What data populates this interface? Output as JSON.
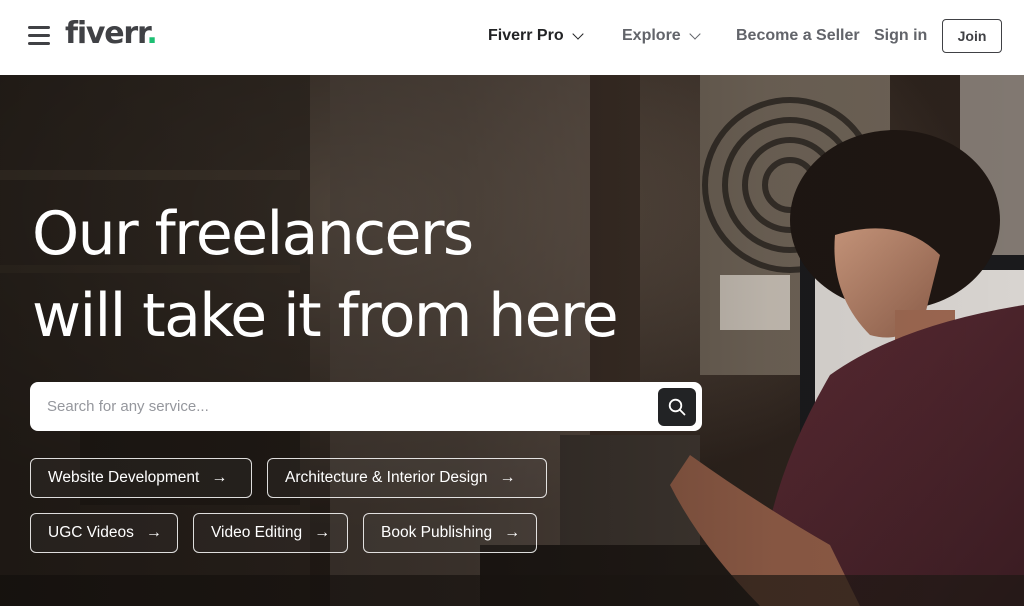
{
  "header": {
    "logo_text": "fiverr",
    "logo_dot": ".",
    "nav": {
      "pro_label": "Fiverr Pro",
      "explore_label": "Explore",
      "become_seller_label": "Become a Seller",
      "sign_in_label": "Sign in",
      "join_label": "Join"
    }
  },
  "hero": {
    "title_line1": "Our freelancers",
    "title_line2": "will take it from here",
    "search": {
      "placeholder": "Search for any service...",
      "value": ""
    },
    "chips": [
      {
        "label": "Website Development"
      },
      {
        "label": "Architecture & Interior Design"
      },
      {
        "label": "UGC Videos"
      },
      {
        "label": "Video Editing"
      },
      {
        "label": "Book Publishing"
      }
    ],
    "chip_arrow": "→"
  },
  "colors": {
    "brand_green": "#1dbf73",
    "text_dark": "#404145",
    "search_button": "#222325"
  },
  "icons": [
    "menu-icon",
    "chevron-down-icon",
    "search-icon",
    "arrow-right-icon"
  ]
}
